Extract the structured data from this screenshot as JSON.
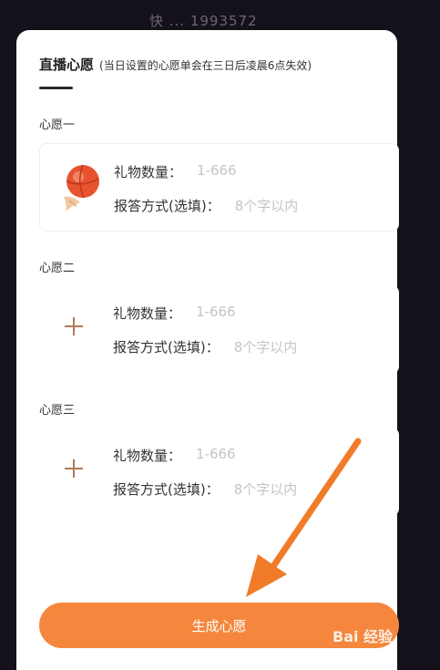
{
  "header_strip": {
    "text": "快 ... 1993572"
  },
  "panel": {
    "title": "直播心愿",
    "subtitle": "(当日设置的心愿单会在三日后凌晨6点失效)"
  },
  "wishes": [
    {
      "label": "心愿一",
      "icon": "gift-basketball-icon",
      "gift_count_label": "礼物数量：",
      "gift_count_placeholder": "1-666",
      "reply_label": "报答方式(选填)：",
      "reply_placeholder": "8个字以内"
    },
    {
      "label": "心愿二",
      "icon": "plus-icon",
      "gift_count_label": "礼物数量：",
      "gift_count_placeholder": "1-666",
      "reply_label": "报答方式(选填)：",
      "reply_placeholder": "8个字以内"
    },
    {
      "label": "心愿三",
      "icon": "plus-icon",
      "gift_count_label": "礼物数量：",
      "gift_count_placeholder": "1-666",
      "reply_label": "报答方式(选填)：",
      "reply_placeholder": "8个字以内"
    }
  ],
  "generate_button": {
    "label": "生成心愿"
  },
  "annotation": {
    "arrow_color": "#f07c2a"
  },
  "watermark": {
    "text": "Bai 经验"
  },
  "colors": {
    "accent": "#f4873d",
    "placeholder": "#c9c4c0",
    "plus": "#b07a5a"
  }
}
